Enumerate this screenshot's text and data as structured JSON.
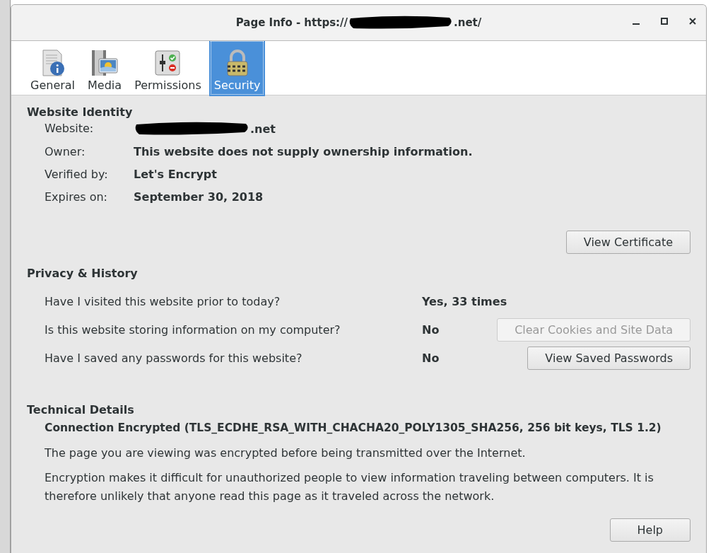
{
  "window": {
    "title_prefix": "Page Info - https://",
    "title_suffix": ".net/"
  },
  "tabs": [
    {
      "label": "General",
      "kind": "general",
      "selected": false
    },
    {
      "label": "Media",
      "kind": "media",
      "selected": false
    },
    {
      "label": "Permissions",
      "kind": "permissions",
      "selected": false
    },
    {
      "label": "Security",
      "kind": "security",
      "selected": true
    }
  ],
  "identity": {
    "heading": "Website Identity",
    "rows": [
      {
        "label": "Website:",
        "value": ".net",
        "redacted": true
      },
      {
        "label": "Owner:",
        "value": "This website does not supply ownership information.",
        "redacted": false
      },
      {
        "label": "Verified by:",
        "value": "Let's Encrypt",
        "redacted": false
      },
      {
        "label": "Expires on:",
        "value": "September 30, 2018",
        "redacted": false
      }
    ],
    "button": "View Certificate"
  },
  "privacy": {
    "heading": "Privacy & History",
    "rows": [
      {
        "question": "Have I visited this website prior to today?",
        "answer": "Yes, 33 times"
      },
      {
        "question": "Is this website storing information on my computer?",
        "answer": "No",
        "button": {
          "label": "Clear Cookies and Site Data",
          "disabled": true
        }
      },
      {
        "question": "Have I saved any passwords for this website?",
        "answer": "No",
        "button": {
          "label": "View Saved Passwords",
          "disabled": false
        }
      }
    ]
  },
  "technical": {
    "heading": "Technical Details",
    "summary": "Connection Encrypted (TLS_ECDHE_RSA_WITH_CHACHA20_POLY1305_SHA256, 256 bit keys, TLS 1.2)",
    "paragraphs": [
      "The page you are viewing was encrypted before being transmitted over the Internet.",
      "Encryption makes it difficult for unauthorized people to view information traveling between computers. It is therefore unlikely that anyone read this page as it traveled across the network."
    ]
  },
  "buttons": [
    "Help"
  ]
}
